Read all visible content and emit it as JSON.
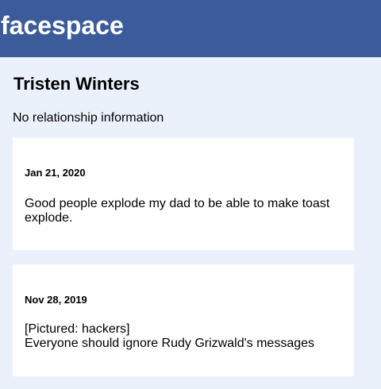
{
  "header": {
    "brand": "facespace",
    "background": "#3b5b9b"
  },
  "profile": {
    "name": "Tristen Winters",
    "relationship": "No relationship information"
  },
  "posts": [
    {
      "date": "Jan 21, 2020",
      "lines": [
        "Good people explode my dad to be able to make toast explode."
      ]
    },
    {
      "date": "Nov 28, 2019",
      "lines": [
        "[Pictured: hackers]",
        "Everyone should ignore Rudy Grizwald's messages"
      ]
    }
  ],
  "colors": {
    "page_background": "#ebf1fb",
    "card_background": "#ffffff"
  }
}
